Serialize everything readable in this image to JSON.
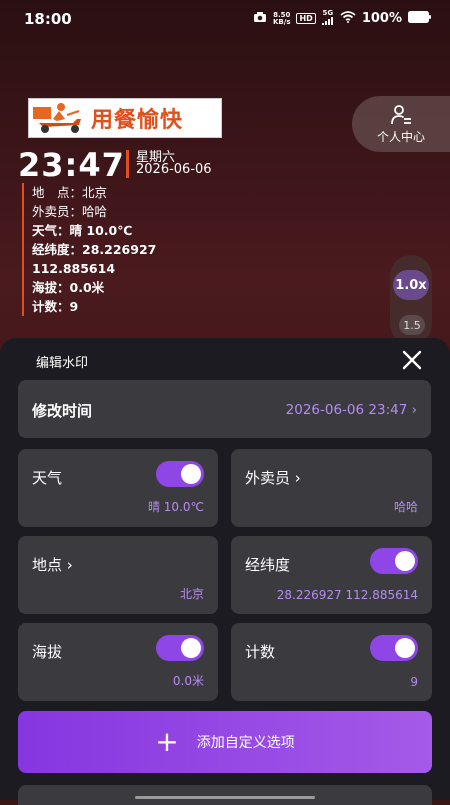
{
  "status": {
    "time": "18:00",
    "net_speed": "8.50",
    "net_unit": "KB/s",
    "hd": "HD",
    "network": "5G",
    "battery": "100%"
  },
  "watermark": {
    "logo_text": "用餐愉快",
    "time": "23:47",
    "weekday": "星期六",
    "date": "2026-06-06",
    "location_label": "地　点：",
    "location_value": "北京",
    "courier_label": "外卖员：",
    "courier_value": "哈哈",
    "weather_label": "天气：",
    "weather_value": "晴 10.0℃",
    "coords_label": "经纬度：",
    "lat": "28.226927",
    "lng": "112.885614",
    "altitude_label": "海拔：",
    "altitude_value": "0.0米",
    "count_label": "计数：",
    "count_value": "9"
  },
  "personal_center": {
    "label": "个人中心"
  },
  "speed": {
    "active": "1.0x",
    "other": "1.5"
  },
  "sheet": {
    "title": "编辑水印",
    "time_label": "修改时间",
    "time_value": "2026-06-06 23:47",
    "add_label": "添加自定义选项"
  },
  "tiles": {
    "weather": {
      "label": "天气",
      "value": "晴  10.0℃",
      "enabled": true
    },
    "courier": {
      "label": "外卖员",
      "value": "哈哈"
    },
    "location": {
      "label": "地点",
      "value": "北京"
    },
    "coords": {
      "label": "经纬度",
      "value": "28.226927  112.885614",
      "enabled": true
    },
    "altitude": {
      "label": "海拔",
      "value": "0.0米",
      "enabled": true
    },
    "count": {
      "label": "计数",
      "value": "9",
      "enabled": true
    }
  },
  "colors": {
    "accent": "#8e46e6",
    "value_text": "#b68cf2",
    "watermark_bar": "#e0501c",
    "card_bg": "#3b3b3f",
    "sheet_bg": "#1c1b22"
  }
}
